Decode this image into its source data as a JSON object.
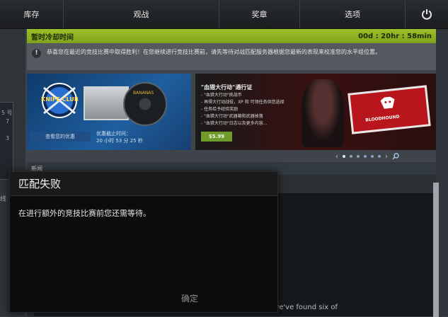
{
  "topbar": {
    "items": [
      "库存",
      "观战",
      "奖章",
      "选项"
    ],
    "power_icon": "power-icon"
  },
  "left_panel": {
    "numbers": [
      "5 号",
      "7",
      "3"
    ],
    "text": "线"
  },
  "cooldown": {
    "title": "暂时冷却时间",
    "timer": "00d : 20hr : 58min"
  },
  "notice": {
    "icon_label": "!",
    "text": "恭喜您在最近的竞技比赛中取得胜利！在您继续进行竞技比赛前，请先等待对战匹配服务器根据您最新的表现来校准您的水平组位置。"
  },
  "promo": {
    "left": {
      "club_text": "KNIFE CLUB",
      "disc_label": "BANANAS",
      "button": "查看您的优惠",
      "deadline_label": "优惠截止时间：",
      "deadline_value": "20 小时 53 分 25 秒"
    },
    "right": {
      "title": "\"血猎大行动\"通行证",
      "bullets": [
        "- \"血猎大行动\"挑战币",
        "- 再得大行动战役，XP 和 可领任务供您选择",
        "- 任务给予经验奖励",
        "- \"血猎大行动\"武器箱和武器掉落",
        "- \"血猎大行动\"日志以及更多内容..."
      ],
      "price": "$5.99",
      "ticket_label": "BLOODHOUND"
    },
    "carousel": {
      "prev": "‹",
      "next": "›",
      "dots": 6,
      "active_dot": 0,
      "search_icon": "magnifier-icon"
    }
  },
  "news": {
    "header": "新闻",
    "snippet": "The Asian and European qualifiers have come and gone, and we've found six of"
  },
  "modal": {
    "title": "匹配失败",
    "message": "在进行额外的竞技比赛前您还需等待。",
    "ok_button": "确定"
  }
}
